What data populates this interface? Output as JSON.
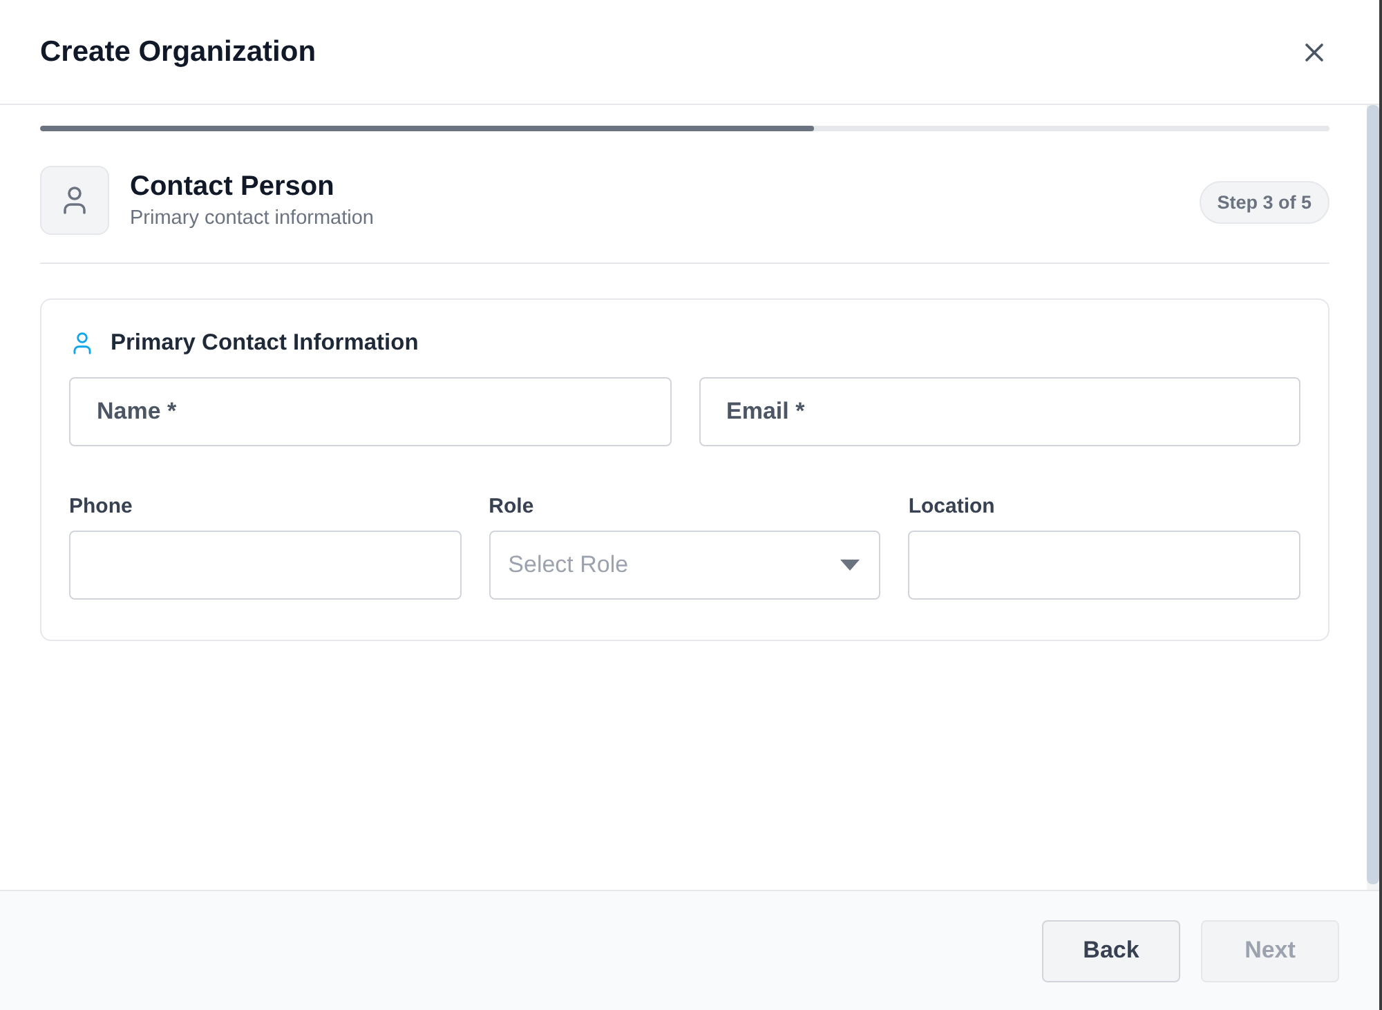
{
  "dialog": {
    "title": "Create Organization"
  },
  "progress": {
    "level": 0.6
  },
  "step": {
    "title": "Contact Person",
    "subtitle": "Primary contact information",
    "badge": "Step 3 of 5"
  },
  "section": {
    "title": "Primary Contact Information",
    "rows": [
      {
        "fields": [
          {
            "kind": "text",
            "placeholder": "Name *"
          },
          {
            "kind": "text",
            "placeholder": "Email *"
          }
        ]
      },
      {
        "fields": [
          {
            "kind": "text",
            "label": "Phone"
          },
          {
            "kind": "select",
            "label": "Role",
            "placeholder": "Select Role"
          },
          {
            "kind": "text",
            "label": "Location"
          }
        ]
      }
    ]
  },
  "buttons": [
    {
      "label": "Back",
      "disabled": false
    },
    {
      "label": "Next",
      "disabled": true
    }
  ]
}
